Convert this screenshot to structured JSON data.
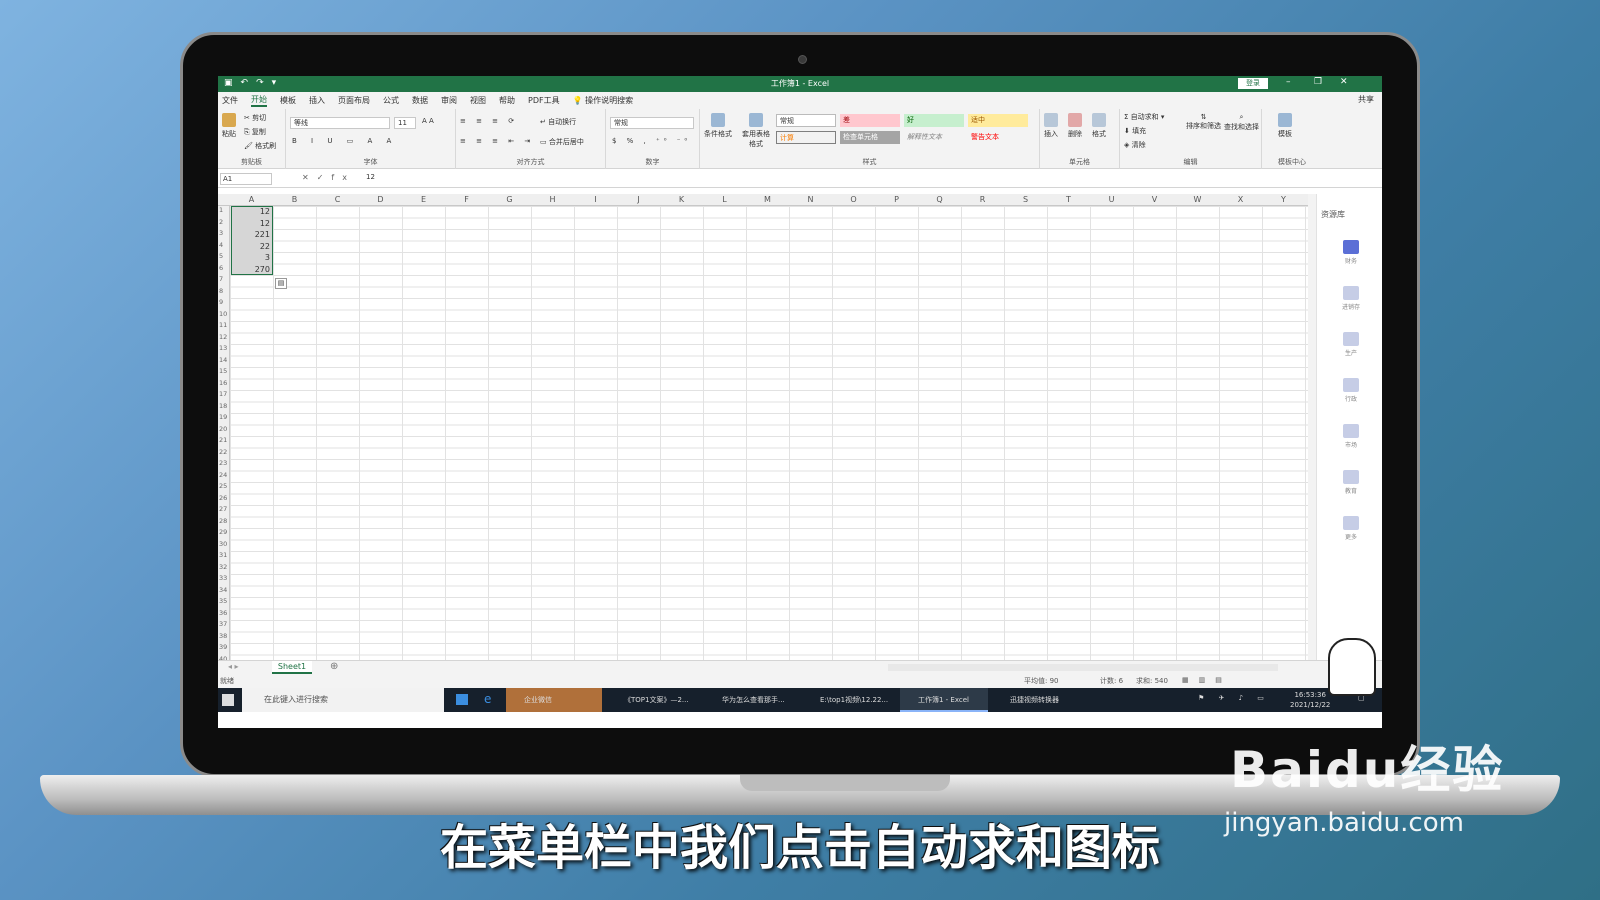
{
  "excel": {
    "window_title": "工作簿1 - Excel",
    "login_label": "登录",
    "share_label": "共享",
    "menu_tabs": [
      "文件",
      "开始",
      "模板",
      "插入",
      "页面布局",
      "公式",
      "数据",
      "审阅",
      "视图",
      "帮助",
      "PDF工具",
      "操作说明搜索"
    ],
    "active_tab": "开始",
    "ribbon": {
      "clipboard": {
        "label": "剪贴板",
        "paste": "粘贴",
        "cut": "剪切",
        "copy": "复制",
        "format_painter": "格式刷"
      },
      "font": {
        "label": "字体",
        "font_name": "等线",
        "font_size": "11"
      },
      "alignment": {
        "label": "对齐方式",
        "wrap_text": "自动换行",
        "merge_center": "合并后居中"
      },
      "number": {
        "label": "数字",
        "format": "常规"
      },
      "styles": {
        "label": "样式",
        "conditional": "条件格式",
        "table_format": "套用表格格式",
        "cell_styles": [
          "常规",
          "差",
          "好",
          "适中",
          "计算",
          "检查单元格",
          "解释性文本",
          "警告文本"
        ]
      },
      "cells": {
        "label": "单元格",
        "insert": "插入",
        "delete": "删除",
        "format": "格式"
      },
      "editing": {
        "label": "编辑",
        "autosum": "自动求和",
        "fill": "填充",
        "clear": "清除",
        "sort_filter": "排序和筛选",
        "find_select": "查找和选择"
      },
      "templates": {
        "label": "模板中心",
        "templates_btn": "模板"
      }
    },
    "name_box": "A1",
    "formula_value": "12",
    "columns": [
      "A",
      "B",
      "C",
      "D",
      "E",
      "F",
      "G",
      "H",
      "I",
      "J",
      "K",
      "L",
      "M",
      "N",
      "O",
      "P",
      "Q",
      "R",
      "S",
      "T",
      "U",
      "V",
      "W",
      "X",
      "Y"
    ],
    "rows": [
      "1",
      "2",
      "3",
      "4",
      "5",
      "6",
      "7",
      "8",
      "9",
      "10",
      "11",
      "12",
      "13",
      "14",
      "15",
      "16",
      "17",
      "18",
      "19",
      "20",
      "21",
      "22",
      "23",
      "24",
      "25",
      "26",
      "27",
      "28",
      "29",
      "30",
      "31",
      "32",
      "33",
      "34",
      "35",
      "36",
      "37",
      "38",
      "39",
      "40"
    ],
    "cells": [
      "12",
      "12",
      "221",
      "22",
      "3",
      "270"
    ],
    "sheet_tab": "Sheet1",
    "status": {
      "ready": "就绪",
      "average": "平均值: 90",
      "count": "计数: 6",
      "sum": "求和: 540"
    },
    "side_panel": {
      "title": "资源库",
      "items": [
        "财务",
        "进销存",
        "生产",
        "行政",
        "市场",
        "教育",
        "更多"
      ]
    }
  },
  "taskbar": {
    "search_placeholder": "在此键入进行搜索",
    "items": [
      "企业微信",
      "《TOP1文案》—2...",
      "华为怎么查看那手...",
      "E:\\top1视频\\12.22...",
      "工作簿1 - Excel",
      "迅捷视频转换器"
    ],
    "time": "16:53:36",
    "date": "2021/12/22"
  },
  "caption": "在菜单栏中我们点击自动求和图标",
  "watermark": {
    "brand": "Baidu经验",
    "url": "jingyan.baidu.com"
  },
  "colors": {
    "excel_green": "#217346",
    "taskbar": "#16202c"
  }
}
